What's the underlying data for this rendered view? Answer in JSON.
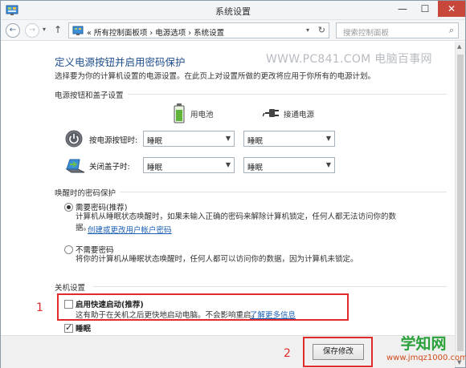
{
  "window": {
    "title": "系统设置",
    "close_symbol": "✕",
    "min_symbol": "—",
    "max_symbol": "☐"
  },
  "address": {
    "recent_symbol": "▾",
    "path_prefix": "«",
    "crumbs": [
      "所有控制面板项",
      "电源选项",
      "系统设置"
    ],
    "separator": "›",
    "search_placeholder": "搜索控制面板"
  },
  "page": {
    "title": "定义电源按钮并启用密码保护",
    "watermark": "WWW.PC841.COM 电脑百事网",
    "description": "选择要为你的计算机设置的电源设置。在此页上对设置所做的更改将应用于你所有的电源计划。"
  },
  "power_section": {
    "label": "电源按钮和盖子设置",
    "columns": {
      "battery": "用电池",
      "plugged": "接通电源"
    },
    "rows": [
      {
        "label": "按电源按钮时:",
        "battery_value": "睡眠",
        "plugged_value": "睡眠",
        "icon": "power-button-icon"
      },
      {
        "label": "关闭盖子时:",
        "battery_value": "睡眠",
        "plugged_value": "睡眠",
        "icon": "laptop-lid-icon"
      }
    ]
  },
  "password_section": {
    "label": "唤醒时的密码保护",
    "require": {
      "label": "需要密码(推荐)",
      "desc1": "计算机从睡眠状态唤醒时，如果未输入正确的密码来解除计算机锁定，任何人都无法访问你的数",
      "desc2": "据。",
      "link": "创建或更改用户帐户密码",
      "selected": true
    },
    "no_require": {
      "label": "不需要密码",
      "desc": "将你的计算机从睡眠状态唤醒时，任何人都可以访问你的数据，因为计算机未锁定。",
      "selected": false
    }
  },
  "shutdown_section": {
    "label": "关机设置",
    "fast_startup": {
      "label": "启用快速启动(推荐)",
      "desc": "这有助于在关机之后更快地启动电脑。不会影响重启。",
      "link": "了解更多信息",
      "checked": false
    },
    "sleep": {
      "label": "睡眠",
      "checked": true
    }
  },
  "annotations": {
    "callout1": "1",
    "callout2": "2",
    "color": "#e12a2a"
  },
  "footer": {
    "save_label": "保存修改"
  },
  "brand": {
    "main": "学知网",
    "sub": "www.jmqz1000.com"
  },
  "colors": {
    "title_blue": "#1e4e8c",
    "link_blue": "#1a5fb4",
    "close_red": "#c7483a",
    "brand_green": "#2ba13b"
  }
}
